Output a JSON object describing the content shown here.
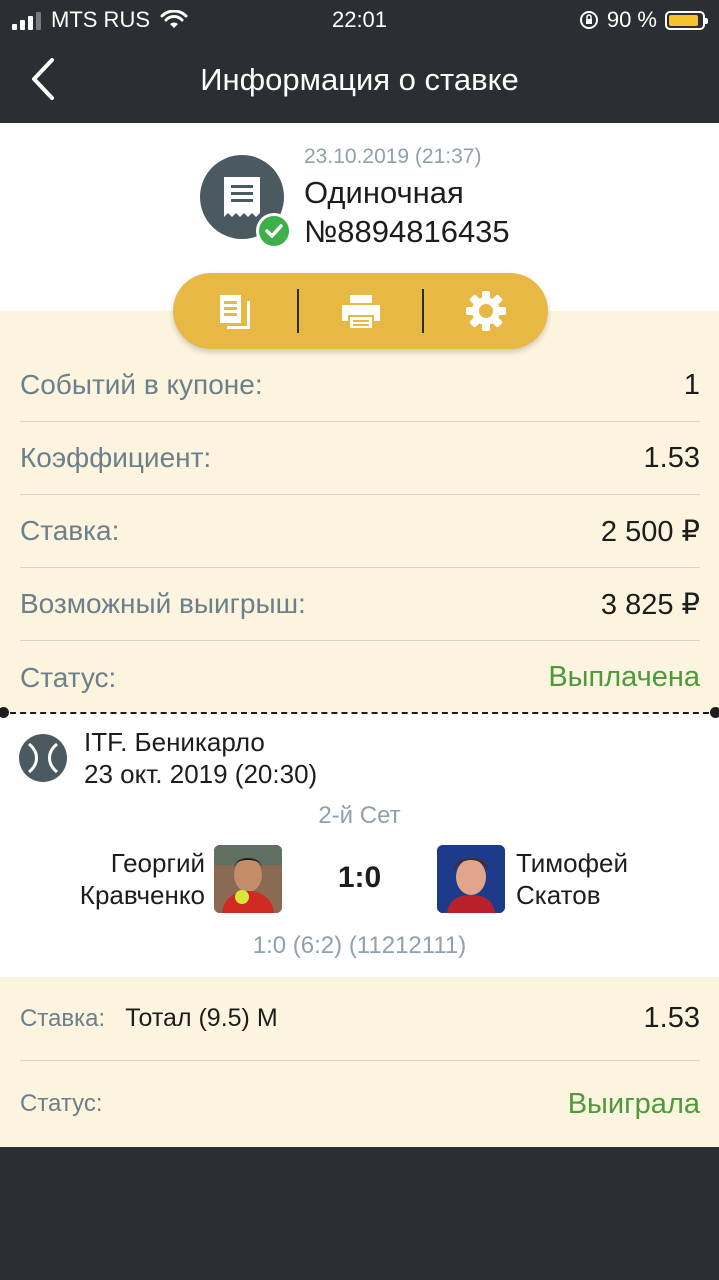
{
  "status_bar": {
    "carrier": "MTS RUS",
    "time": "22:01",
    "battery_text": "90 %",
    "battery_level": 0.9
  },
  "nav": {
    "title": "Информация о ставке"
  },
  "bet": {
    "datetime": "23.10.2019 (21:37)",
    "type": "Одиночная",
    "number": "№8894816435"
  },
  "summary": [
    {
      "label": "Событий в купоне:",
      "value": "1"
    },
    {
      "label": "Коэффициент:",
      "value": "1.53"
    },
    {
      "label": "Ставка:",
      "value": "2 500 ₽"
    },
    {
      "label": "Возможный выигрыш:",
      "value": "3 825 ₽"
    },
    {
      "label": "Статус:",
      "value": "Выплачена"
    }
  ],
  "event": {
    "tournament": "ITF. Беникарло",
    "date": "23 окт. 2019 (20:30)",
    "period": "2-й Сет",
    "player1_first": "Георгий",
    "player1_last": "Кравченко",
    "player2_first": "Тимофей",
    "player2_last": "Скатов",
    "score": "1:0",
    "detail_score": "1:0 (6:2) (11212111)"
  },
  "bet_detail": {
    "stake_label": "Ставка:",
    "market": "Тотал (9.5) М",
    "odds": "1.53",
    "status_label": "Статус:",
    "status": "Выиграла"
  },
  "colors": {
    "dark": "#2b2f33",
    "accent": "#e7b944",
    "cream": "#fcf4de",
    "green": "#4c9a3a",
    "muted": "#8fa1ab"
  }
}
